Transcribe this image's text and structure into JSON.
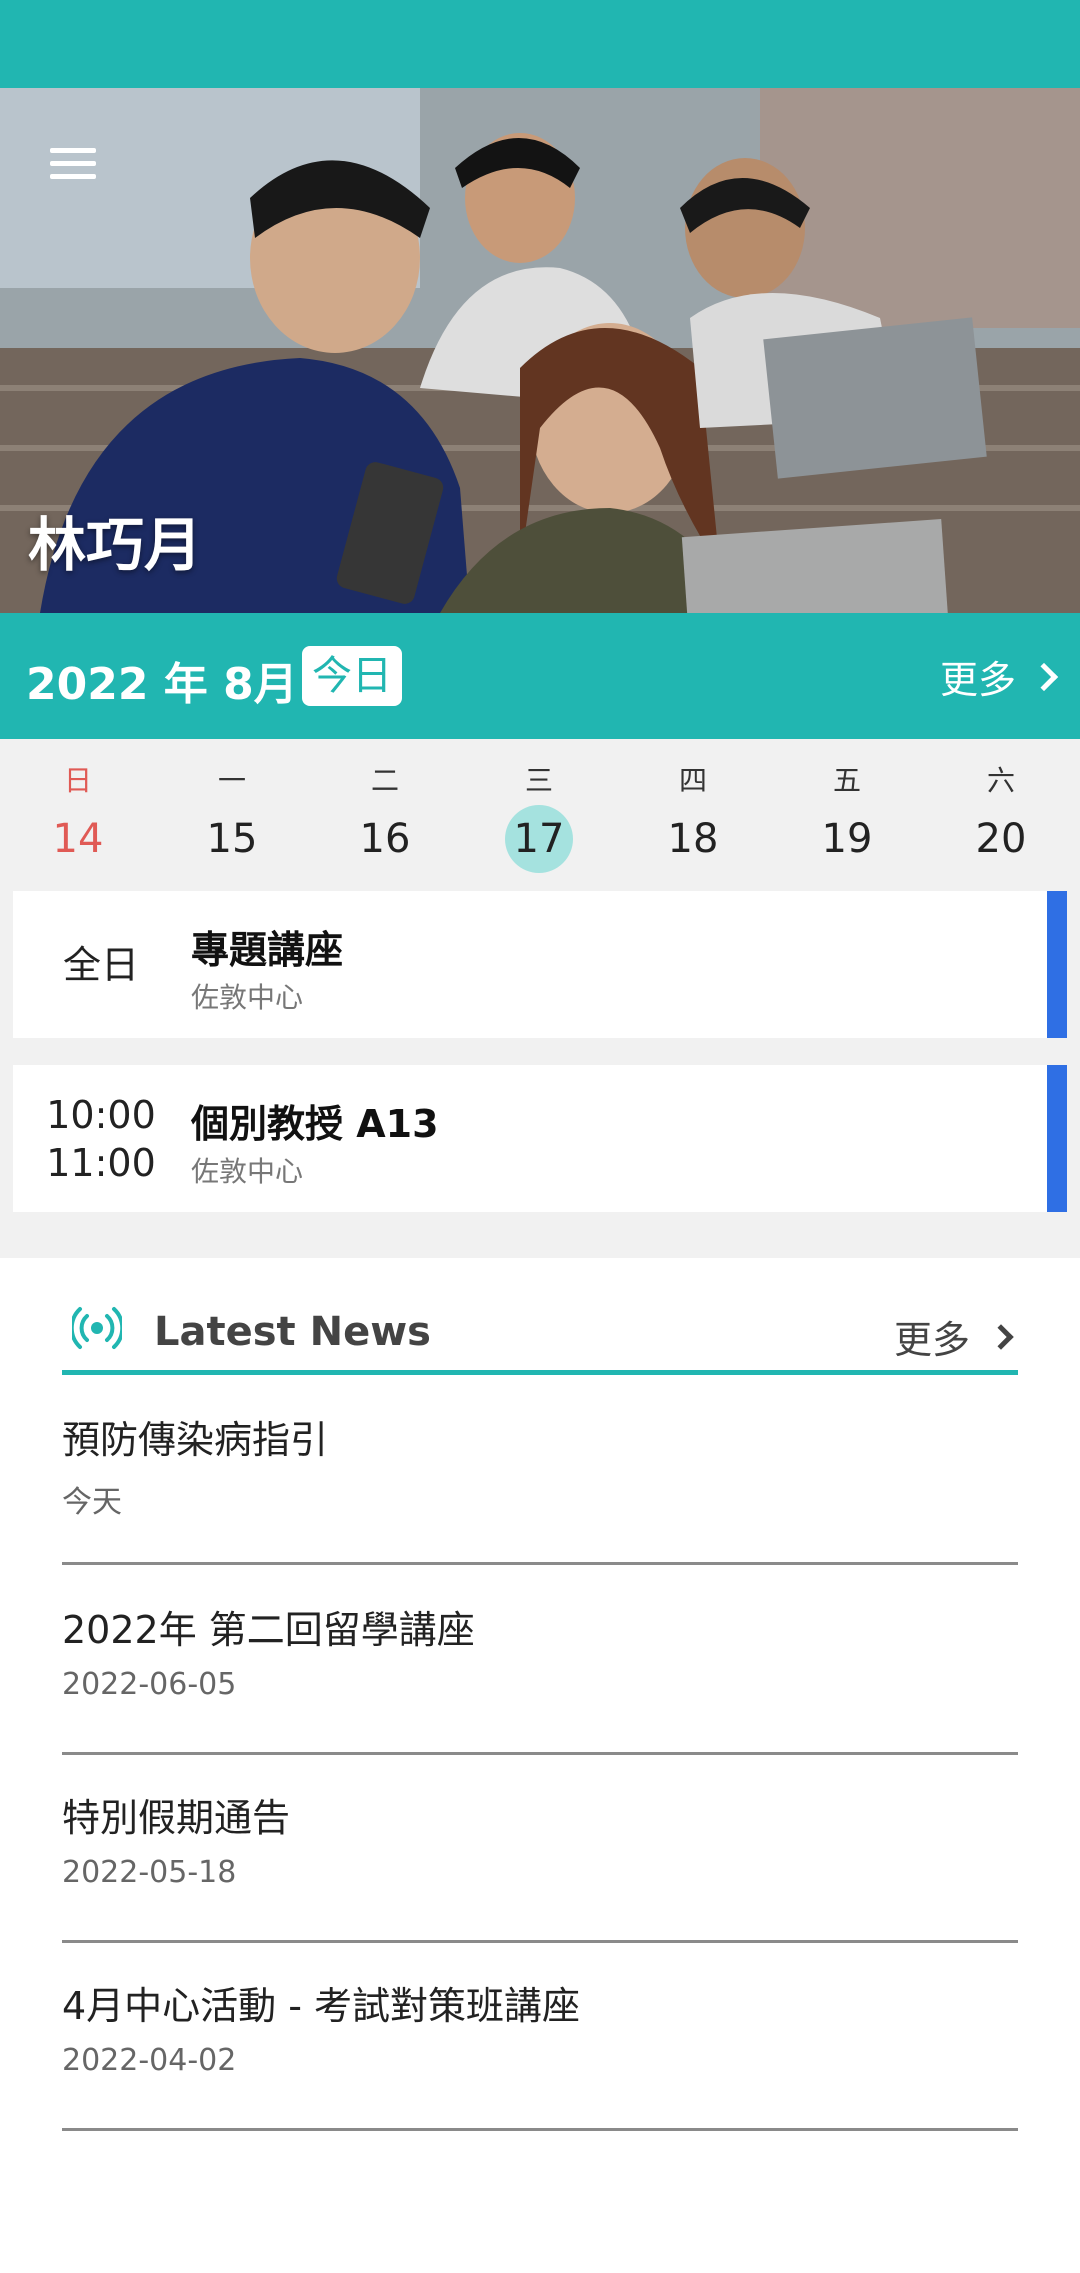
{
  "user": {
    "name": "林巧月"
  },
  "calendar": {
    "month_label": "2022 年 8月",
    "today_label": "今日",
    "more_label": "更多",
    "days": [
      {
        "weekday": "日",
        "date": "14"
      },
      {
        "weekday": "一",
        "date": "15"
      },
      {
        "weekday": "二",
        "date": "16"
      },
      {
        "weekday": "三",
        "date": "17"
      },
      {
        "weekday": "四",
        "date": "18"
      },
      {
        "weekday": "五",
        "date": "19"
      },
      {
        "weekday": "六",
        "date": "20"
      }
    ],
    "selected_date": "17"
  },
  "events": [
    {
      "time": "全日",
      "title": "專題講座",
      "location": "佐敦中心"
    },
    {
      "start": "10:00",
      "end": "11:00",
      "title": "個別教授 A13",
      "location": "佐敦中心"
    }
  ],
  "news": {
    "title": "Latest News",
    "more_label": "更多",
    "items": [
      {
        "title": "預防傳染病指引",
        "date": "今天"
      },
      {
        "title": "2022年 第二回留學講座",
        "date": "2022-06-05"
      },
      {
        "title": "特別假期通告",
        "date": "2022-05-18"
      },
      {
        "title": "4月中心活動 - 考試對策班講座",
        "date": "2022-04-02"
      }
    ]
  },
  "colors": {
    "accent": "#21b6b1",
    "event_bar": "#2f6fe4",
    "sunday": "#e05a55",
    "selected": "#a5e2df"
  },
  "icons": {
    "menu": "hamburger-icon",
    "more": "chevron-right-icon",
    "news": "broadcast-icon"
  }
}
